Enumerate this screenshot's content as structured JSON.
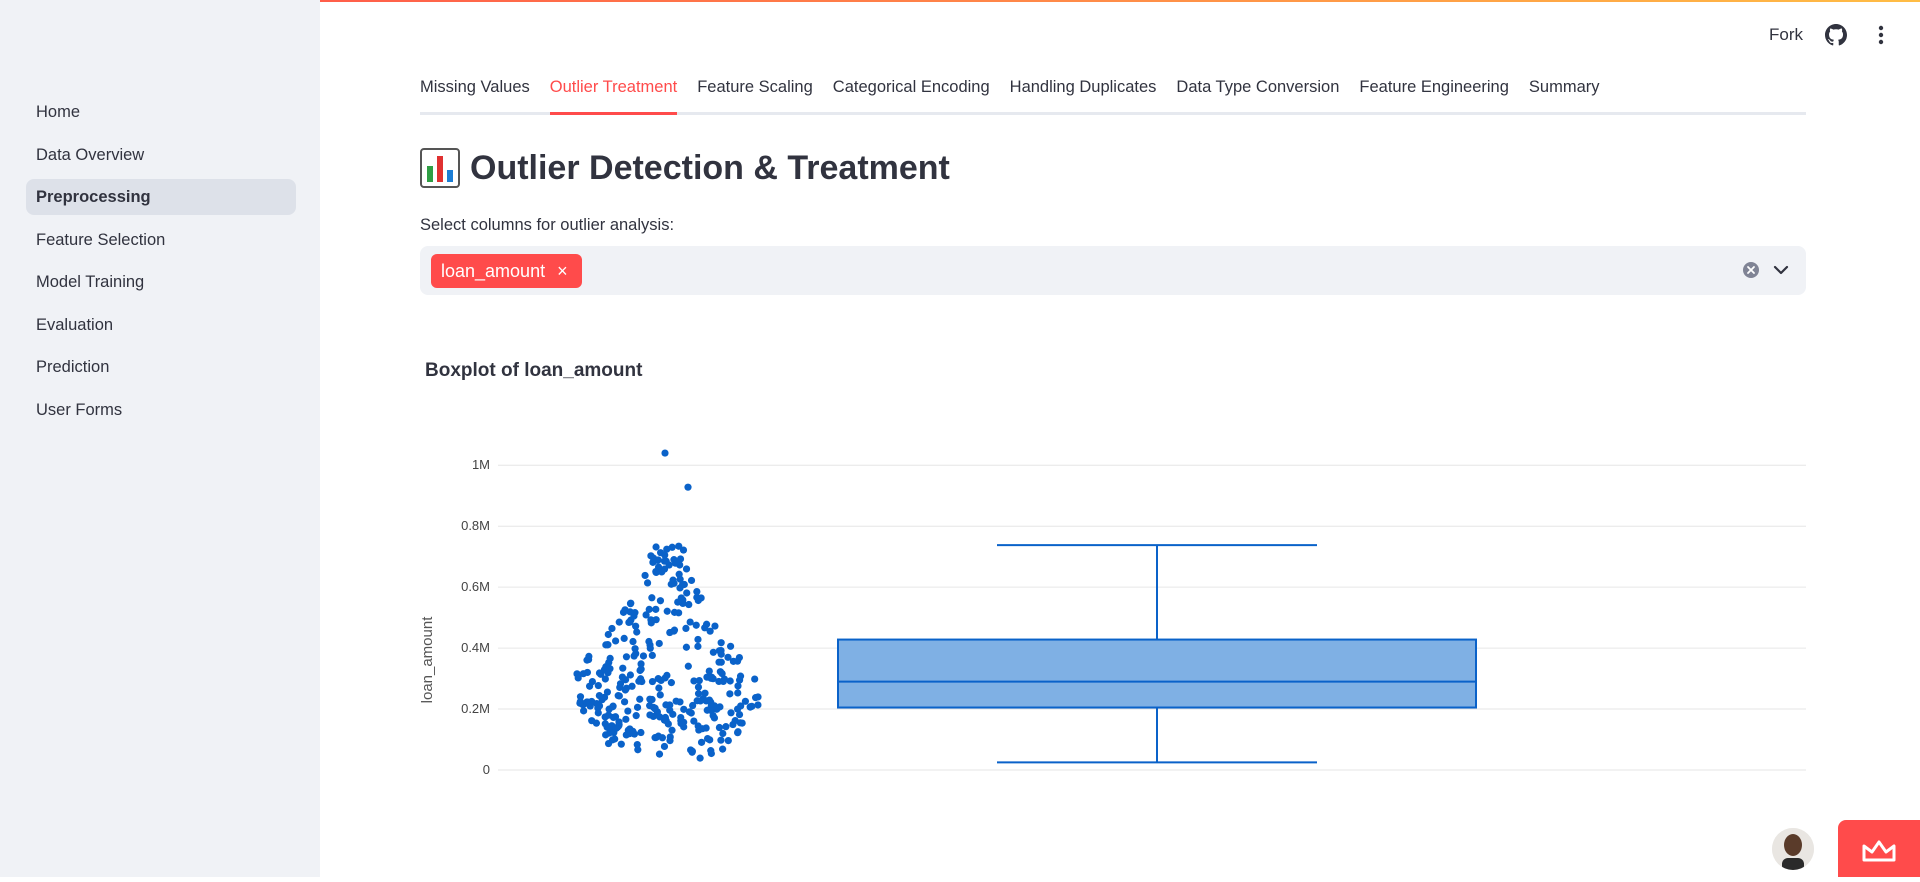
{
  "sidebar": {
    "items": [
      {
        "label": "Home"
      },
      {
        "label": "Data Overview"
      },
      {
        "label": "Preprocessing",
        "active": true
      },
      {
        "label": "Feature Selection"
      },
      {
        "label": "Model Training"
      },
      {
        "label": "Evaluation"
      },
      {
        "label": "Prediction"
      },
      {
        "label": "User Forms"
      }
    ]
  },
  "header": {
    "fork_label": "Fork",
    "icons": [
      "github-icon",
      "kebab-menu-icon"
    ]
  },
  "tabs": [
    {
      "label": "Missing Values"
    },
    {
      "label": "Outlier Treatment",
      "active": true
    },
    {
      "label": "Feature Scaling"
    },
    {
      "label": "Categorical Encoding"
    },
    {
      "label": "Handling Duplicates"
    },
    {
      "label": "Data Type Conversion"
    },
    {
      "label": "Feature Engineering"
    },
    {
      "label": "Summary"
    }
  ],
  "main": {
    "title": "Outlier Detection & Treatment",
    "title_icon": "bar-chart-emoji",
    "select_label": "Select columns for outlier analysis:",
    "selected_chips": [
      {
        "label": "loan_amount",
        "remove_glyph": "×"
      }
    ],
    "chart_title": "Boxplot of loan_amount"
  },
  "colors": {
    "accent": "#ff4b4b",
    "box_fill": "#7fb0e4",
    "box_stroke": "#0a62c9",
    "point": "#0a62c9",
    "sidebar_bg": "#f0f2f6"
  },
  "chart_data": {
    "type": "box",
    "ylabel": "loan_amount",
    "ylim": [
      0,
      1050000
    ],
    "ytick_labels": [
      "0",
      "0.2M",
      "0.4M",
      "0.6M",
      "0.8M",
      "1M"
    ],
    "ytick_values": [
      0,
      200000,
      400000,
      600000,
      800000,
      1000000
    ],
    "grid": true,
    "box": {
      "lower_whisker": 25000,
      "q1": 205000,
      "median": 290000,
      "q3": 428000,
      "upper_whisker": 738000
    },
    "points_shown": "all",
    "point_range": [
      25000,
      740000
    ],
    "outliers": [
      1040000,
      928000
    ]
  }
}
